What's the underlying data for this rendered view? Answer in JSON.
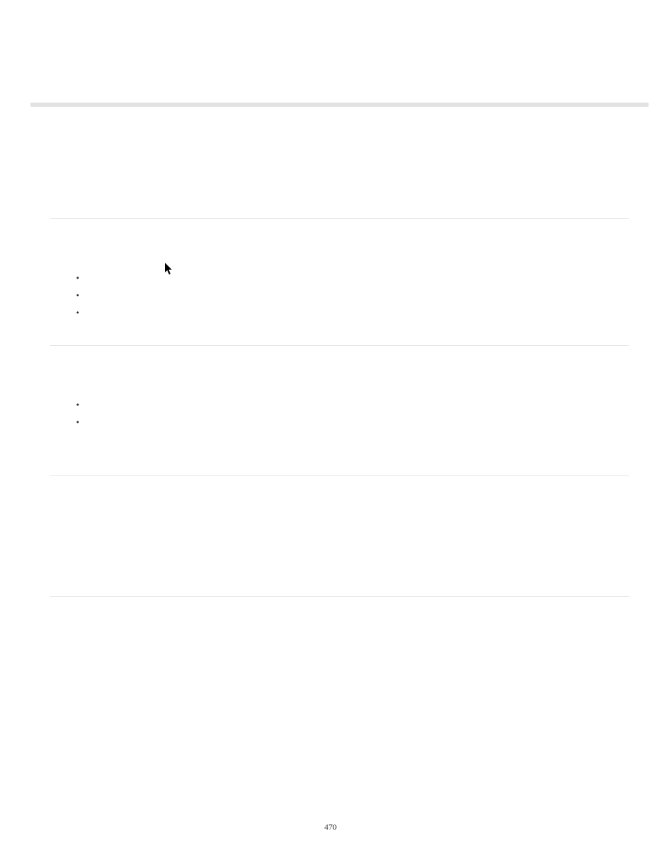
{
  "page": {
    "number": "470"
  },
  "sections": [
    {
      "bullets": [
        "",
        "",
        ""
      ]
    },
    {
      "bullets": [
        "",
        ""
      ]
    },
    {
      "bullets": []
    },
    {
      "bullets": []
    }
  ]
}
